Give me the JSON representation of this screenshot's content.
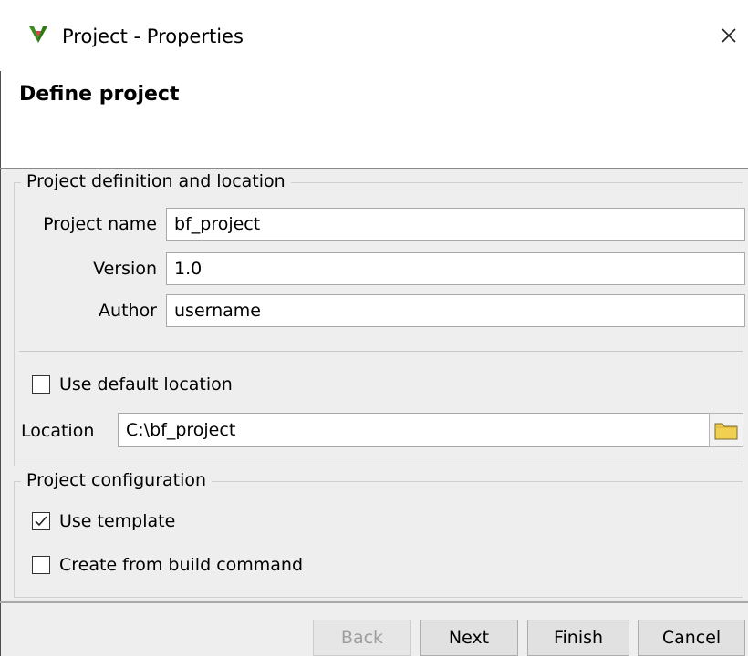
{
  "window": {
    "title": "Project - Properties",
    "app_icon": "v-logo-icon",
    "close_icon": "close-icon"
  },
  "header": {
    "title": "Define project"
  },
  "definition_group": {
    "legend": "Project definition and location",
    "project_name_label": "Project name",
    "project_name_value": "bf_project",
    "version_label": "Version",
    "version_value": "1.0",
    "author_label": "Author",
    "author_value": "username",
    "use_default_location_label": "Use default location",
    "use_default_location_checked": false,
    "location_label": "Location",
    "location_value": "C:\\bf_project",
    "browse_icon": "folder-icon"
  },
  "configuration_group": {
    "legend": "Project configuration",
    "use_template_label": "Use template",
    "use_template_checked": true,
    "create_from_build_label": "Create from build command",
    "create_from_build_checked": false
  },
  "buttons": {
    "back": "Back",
    "back_disabled": true,
    "next": "Next",
    "finish": "Finish",
    "cancel": "Cancel"
  },
  "colors": {
    "logo_green": "#3a8d1f",
    "logo_red": "#c62828",
    "folder_yellow": "#f1cf50"
  }
}
